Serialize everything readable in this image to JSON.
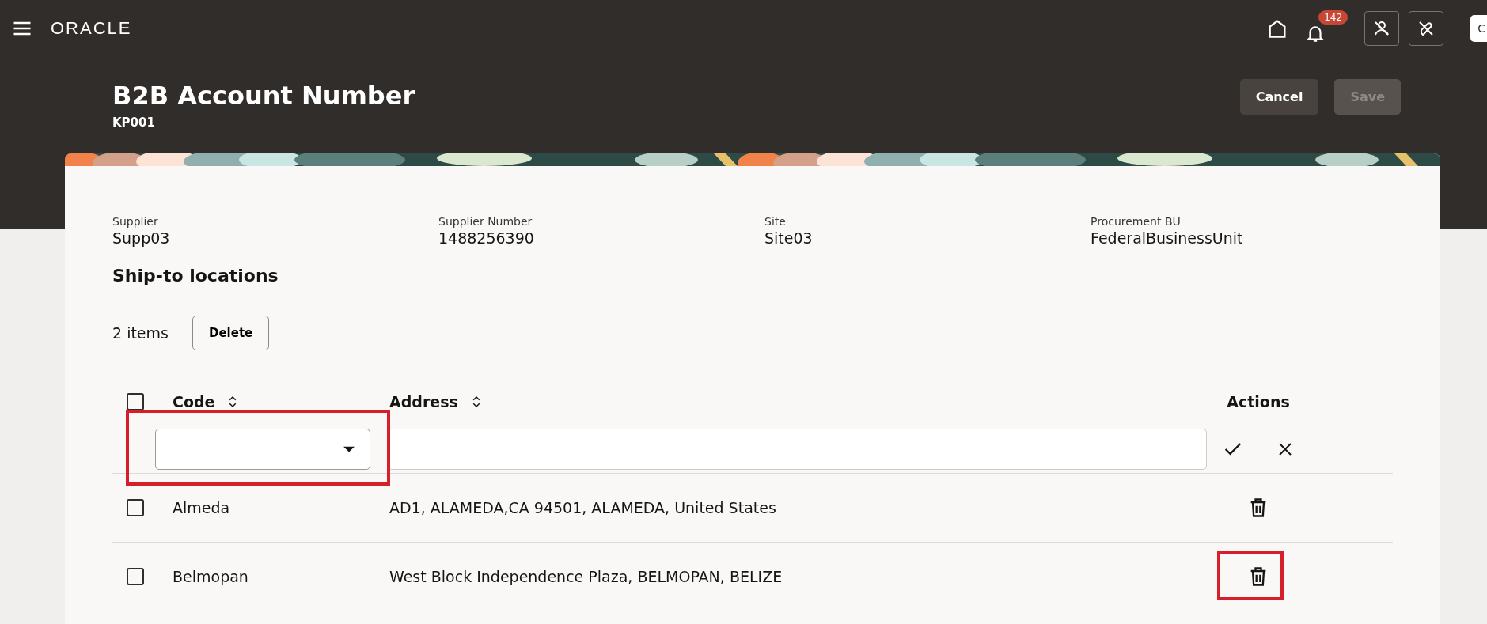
{
  "top_bar": {
    "logo": "ORACLE",
    "notification_count": "142",
    "user_button": "C"
  },
  "header": {
    "title": "B2B Account Number",
    "subtitle": "KP001",
    "buttons": [
      {
        "label": "Cancel",
        "disabled": false
      },
      {
        "label": "Save",
        "disabled": true
      }
    ]
  },
  "details": [
    {
      "label": "Supplier",
      "value": "Supp03"
    },
    {
      "label": "Supplier Number",
      "value": "1488256390"
    },
    {
      "label": "Site",
      "value": "Site03"
    },
    {
      "label": "Procurement BU",
      "value": "FederalBusinessUnit"
    }
  ],
  "section_title": "Ship-to locations",
  "toolbar": {
    "count": "2 items",
    "delete_button": "Delete"
  },
  "table": {
    "select_all_checked": false,
    "columns": [
      {
        "label": "Code",
        "sortable": true
      },
      {
        "label": "Address",
        "sortable": true
      },
      {
        "label": "Actions",
        "sortable": false
      }
    ],
    "new_row": {
      "code_highlighted": true
    },
    "rows": [
      {
        "code": "Almeda",
        "address": "AD1, ALAMEDA,CA 94501, ALAMEDA, United States",
        "checked": false,
        "delete_highlighted": false
      },
      {
        "code": "Belmopan",
        "address": "West Block Independence Plaza, BELMOPAN, BELIZE",
        "checked": false,
        "delete_highlighted": true
      }
    ]
  }
}
